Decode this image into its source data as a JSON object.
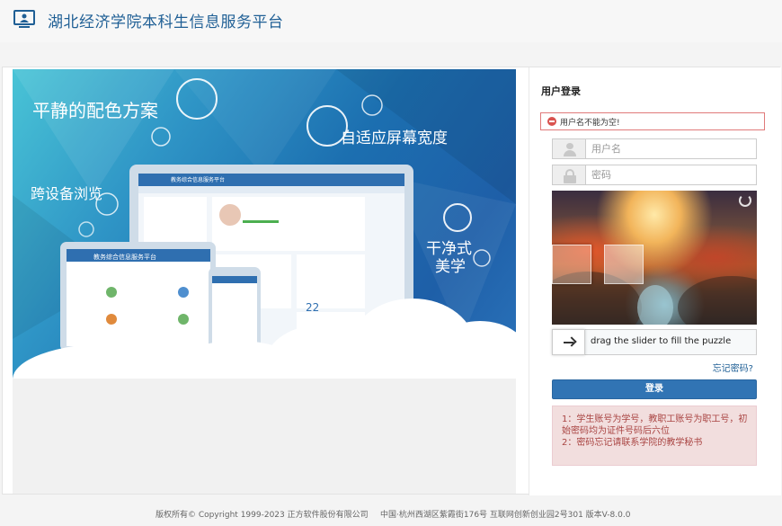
{
  "header": {
    "title": "湖北经济学院本科生信息服务平台",
    "logo_icon": "monitor-user-icon"
  },
  "banner": {
    "slogans": [
      "平静的配色方案",
      "自适应屏幕宽度",
      "跨设备浏览",
      "干净式",
      "美学"
    ],
    "device_titles": {
      "laptop": "教务综合信息服务平台",
      "tablet": "教务综合信息服务平台"
    },
    "calendar_day": "22"
  },
  "login": {
    "title": "用户登录",
    "error": "用户名不能为空!",
    "username": {
      "value": "",
      "placeholder": "用户名"
    },
    "password": {
      "value": "",
      "placeholder": "密码"
    },
    "slider_text": "drag the slider to fill the puzzle",
    "forgot_label": "忘记密码?",
    "submit_label": "登录",
    "notice": [
      "1：学生账号为学号，教职工账号为职工号，初始密码均为证件号码后六位",
      "2：密码忘记请联系学院的教学秘书"
    ],
    "colors": {
      "primary": "#3174b4",
      "error": "#d9534f",
      "notice_bg": "#f2dede",
      "notice_text": "#a94442"
    }
  },
  "footer": {
    "copyright": "版权所有© Copyright 1999-2023 正方软件股份有限公司",
    "address": "中国·杭州西湖区紫霞街176号 互联网创新创业园2号301   版本V-8.0.0"
  }
}
